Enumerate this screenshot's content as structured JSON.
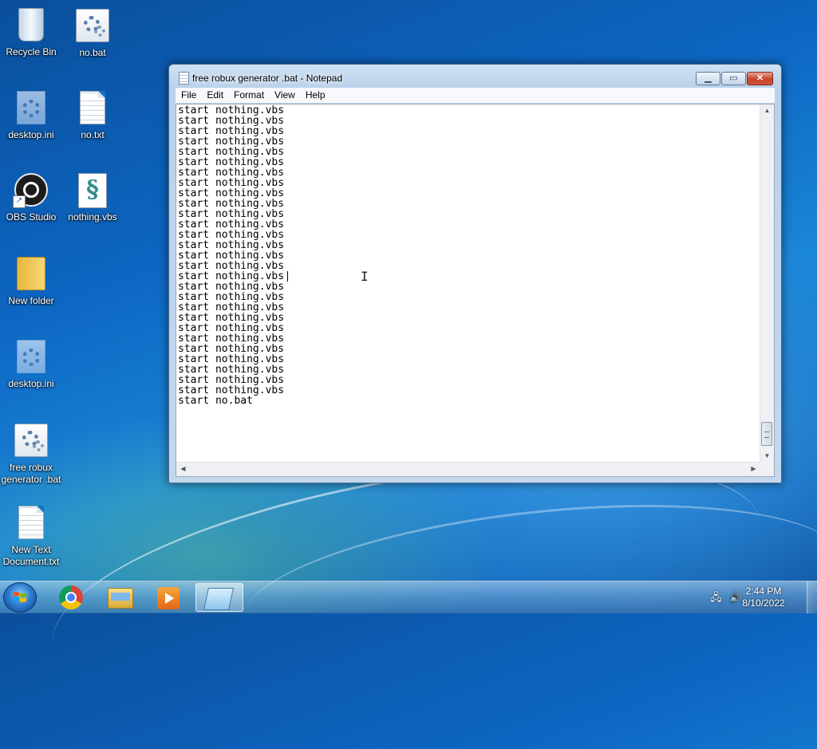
{
  "desktop": {
    "icons": [
      {
        "label": "Recycle Bin",
        "icon": "recycle-bin-icon"
      },
      {
        "label": "no.bat",
        "icon": "batch-file-icon"
      },
      {
        "label": "desktop.ini",
        "icon": "ini-file-icon"
      },
      {
        "label": "no.txt",
        "icon": "text-file-icon"
      },
      {
        "label": "OBS Studio",
        "icon": "obs-studio-icon"
      },
      {
        "label": "nothing.vbs",
        "icon": "vbs-script-icon"
      },
      {
        "label": "New folder",
        "icon": "folder-icon"
      },
      {
        "label": "desktop.ini",
        "icon": "ini-file-icon"
      },
      {
        "label": "free robux generator .bat",
        "icon": "batch-file-icon"
      },
      {
        "label": "New Text Document.txt",
        "icon": "text-file-icon"
      }
    ]
  },
  "window": {
    "title": "free robux generator .bat - Notepad",
    "minimize_symbol": "▁",
    "maximize_symbol": "▭",
    "close_symbol": "✕",
    "menu": [
      "File",
      "Edit",
      "Format",
      "View",
      "Help"
    ],
    "content_lines": [
      "start nothing.vbs",
      "start nothing.vbs",
      "start nothing.vbs",
      "start nothing.vbs",
      "start nothing.vbs",
      "start nothing.vbs",
      "start nothing.vbs",
      "start nothing.vbs",
      "start nothing.vbs",
      "start nothing.vbs",
      "start nothing.vbs",
      "start nothing.vbs",
      "start nothing.vbs",
      "start nothing.vbs",
      "start nothing.vbs",
      "start nothing.vbs",
      "start nothing.vbs",
      "start nothing.vbs",
      "start nothing.vbs",
      "start nothing.vbs",
      "start nothing.vbs",
      "start nothing.vbs",
      "start nothing.vbs",
      "start nothing.vbs",
      "start nothing.vbs",
      "start nothing.vbs",
      "start nothing.vbs",
      "start nothing.vbs",
      "start no.bat"
    ],
    "content_text": "start nothing.vbs\nstart nothing.vbs\nstart nothing.vbs\nstart nothing.vbs\nstart nothing.vbs\nstart nothing.vbs\nstart nothing.vbs\nstart nothing.vbs\nstart nothing.vbs\nstart nothing.vbs\nstart nothing.vbs\nstart nothing.vbs\nstart nothing.vbs\nstart nothing.vbs\nstart nothing.vbs\nstart nothing.vbs\nstart nothing.vbs\nstart nothing.vbs\nstart nothing.vbs\nstart nothing.vbs\nstart nothing.vbs\nstart nothing.vbs\nstart nothing.vbs\nstart nothing.vbs\nstart nothing.vbs\nstart nothing.vbs\nstart nothing.vbs\nstart nothing.vbs\nstart no.bat"
  },
  "taskbar": {
    "apps": [
      {
        "name": "Google Chrome",
        "icon": "chrome-icon"
      },
      {
        "name": "Windows Explorer",
        "icon": "folder-icon"
      },
      {
        "name": "Windows Media Player",
        "icon": "media-player-icon"
      },
      {
        "name": "Notepad",
        "icon": "notepad-icon",
        "active": true
      }
    ],
    "tray": {
      "network_icon": "network-icon",
      "volume_icon": "volume-icon"
    },
    "clock": {
      "time": "2:44 PM",
      "date": "8/10/2022"
    }
  },
  "colors": {
    "desktop_blue": "#0d66c2",
    "close_button_red": "#c8432c",
    "window_frame": "#b9d1ea"
  }
}
